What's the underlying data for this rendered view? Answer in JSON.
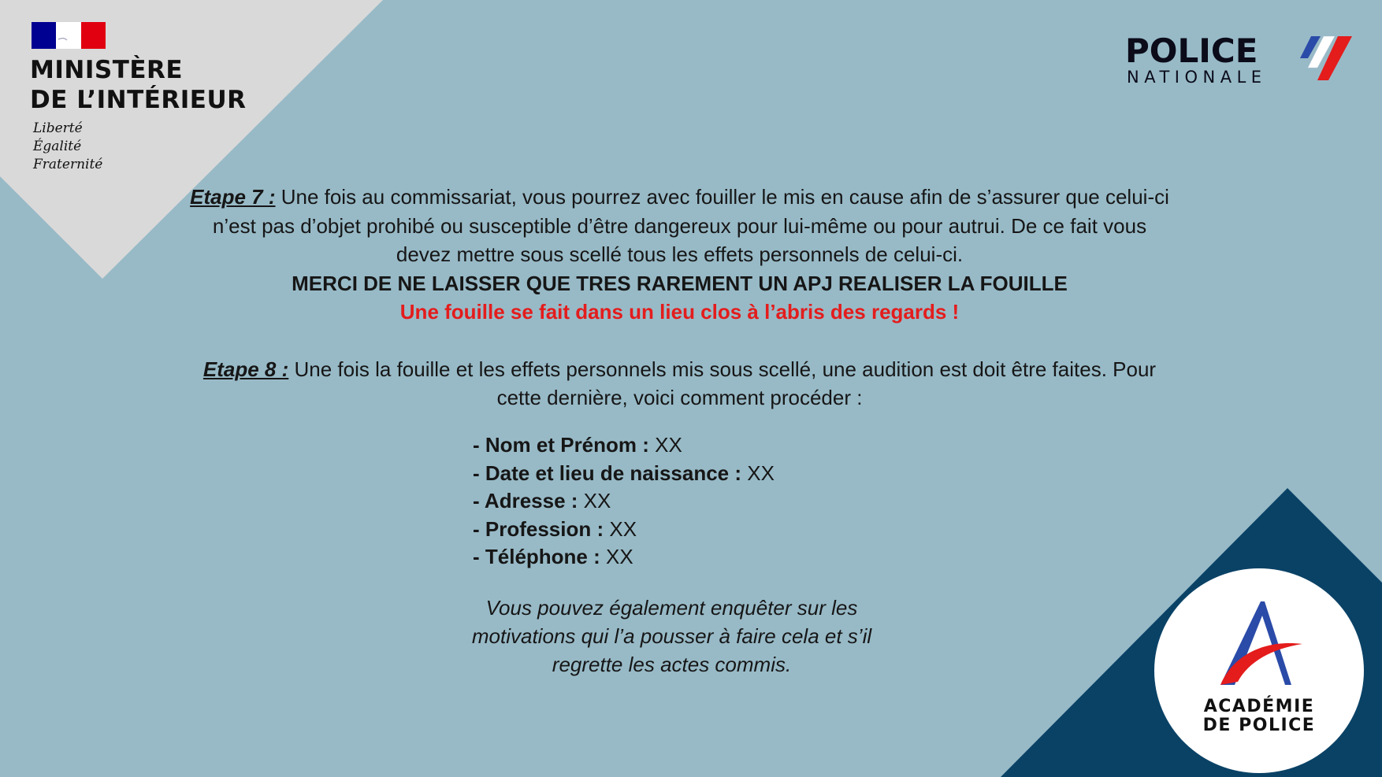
{
  "header": {
    "ministry_line1": "MINISTÈRE",
    "ministry_line2": "DE L’INTÉRIEUR",
    "motto": [
      "Liberté",
      "Égalité",
      "Fraternité"
    ],
    "police_word": "POLICE",
    "nationale_word": "NATIONALE"
  },
  "step7": {
    "label": "Etape 7 :",
    "text": " Une fois au commissariat, vous pourrez avec fouiller le mis en cause afin de s’assurer que celui-ci n’est pas d’objet prohibé ou susceptible d’être dangereux pour lui-même ou pour autrui. De ce fait vous devez mettre sous scellé tous les effets personnels de celui-ci.",
    "warning": "MERCI DE NE LAISSER QUE TRES RAREMENT UN APJ REALISER LA FOUILLE",
    "red_note": "Une fouille se fait dans un lieu clos à l’abris des regards !"
  },
  "step8": {
    "label": "Etape 8 :",
    "text": " Une fois la fouille et les effets personnels mis sous scellé, une audition est doit être faites. Pour cette dernière, voici comment procéder :"
  },
  "fields": [
    {
      "label": "- Nom et Prénom :",
      "value": " XX"
    },
    {
      "label": "- Date et lieu de naissance :",
      "value": " XX"
    },
    {
      "label": "- Adresse :",
      "value": " XX"
    },
    {
      "label": "- Profession :",
      "value": " XX"
    },
    {
      "label": "- Téléphone :",
      "value": " XX"
    }
  ],
  "note": "Vous pouvez également enquêter sur les motivations qui l’a pousser à faire cela et s’il regrette les actes commis.",
  "academy": {
    "line1": "ACADÉMIE",
    "line2": "DE POLICE"
  },
  "colors": {
    "background": "#98bac7",
    "corner_grey": "#d9d9d9",
    "corner_navy": "#0a4266",
    "red": "#e41c1c",
    "blue": "#2b4ba8"
  }
}
